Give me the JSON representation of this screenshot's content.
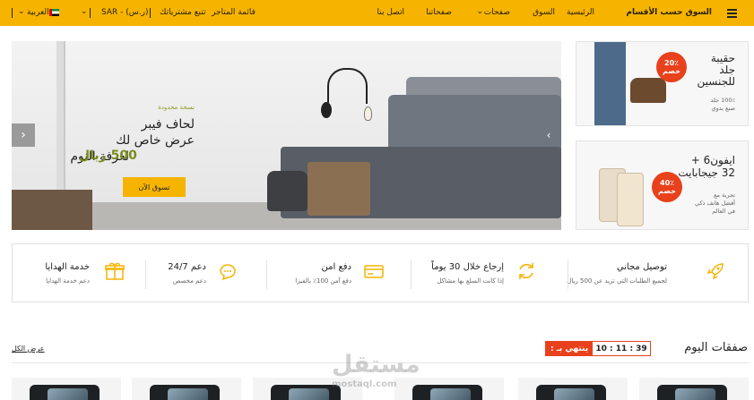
{
  "header": {
    "menu_label": "السوق حسب الأقسام",
    "nav": [
      "الرئيسية",
      "السوق",
      "صفحات",
      "صفحاتنا",
      "اتصل بنا"
    ],
    "links": [
      "قائمة المتاجر",
      "تتبع مشترياتك"
    ],
    "currency": "(ر.س) - SAR",
    "language": "العربية",
    "colors": {
      "accent": "#f6b400"
    }
  },
  "hero": {
    "tag": "نسخة محدودة",
    "line1": "لحاف فيبر",
    "line2": "عرض خاص لك",
    "line3": "لغرفة النوم",
    "price": "500 ريال",
    "button": "تسوق الآن"
  },
  "promo1": {
    "title": [
      "حقيبة",
      "جلد",
      "للجنسين"
    ],
    "sub": [
      "100٪ جلد",
      "صنع يدوي"
    ],
    "badge_pct": "20٪",
    "badge_word": "خصم"
  },
  "promo2": {
    "title": [
      "ايفون6 +",
      "32 جيجابايت"
    ],
    "sub": [
      "تجربة مع",
      "أفضل هاتف ذكي",
      "في العالم"
    ],
    "badge_pct": "40٪",
    "badge_word": "خصم"
  },
  "features": [
    {
      "title": "توصيل مجاني",
      "sub": "لجميع الطلبات التي تزيد عن 500 ريال",
      "icon": "rocket-icon"
    },
    {
      "title": "إرجاع خلال 30 يوماً",
      "sub": "إذا كانت السلع بها مشاكل",
      "icon": "refresh-icon"
    },
    {
      "title": "دفع امن",
      "sub": "دفع آمن 100٪ بالفيزا",
      "icon": "credit-card-icon"
    },
    {
      "title": "دعم 24/7",
      "sub": "دعم مخصص",
      "icon": "chat-icon"
    },
    {
      "title": "خدمة الهدايا",
      "sub": "دعم خدمة الهدايا",
      "icon": "gift-icon"
    }
  ],
  "deals": {
    "title": "صفقات اليوم",
    "ends_label": "ينتهي بـ :",
    "time": "10 : 11 : 39",
    "see_all": "عرض الكل"
  },
  "watermark": {
    "ar": "مستقل",
    "en": "mostaql.com"
  }
}
